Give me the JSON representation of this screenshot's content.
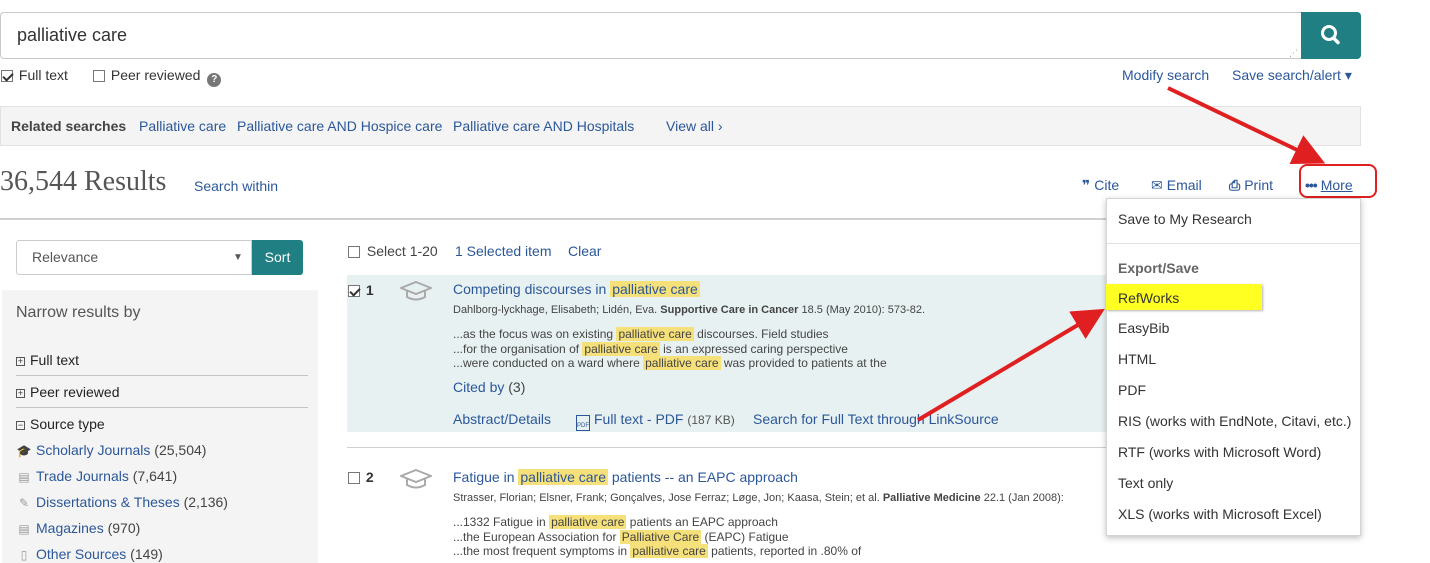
{
  "search": {
    "value": "palliative care",
    "full_text_label": "Full text",
    "peer_reviewed_label": "Peer reviewed",
    "modify_search": "Modify search",
    "save_search": "Save search/alert ▾"
  },
  "related": {
    "heading": "Related searches",
    "links": [
      "Palliative care",
      "Palliative care AND Hospice care",
      "Palliative care AND Hospitals"
    ],
    "view_all": "View all ›"
  },
  "results": {
    "count": "36,544 Results",
    "search_within": "Search within"
  },
  "tools": {
    "cite": "Cite",
    "email": "Email",
    "print": "Print",
    "more": "More"
  },
  "sort": {
    "selected": "Relevance",
    "button": "Sort"
  },
  "narrow": {
    "title": "Narrow results by",
    "facets": [
      "Full text",
      "Peer reviewed",
      "Source type"
    ],
    "sources": [
      {
        "label": "Scholarly Journals",
        "count": "(25,504)"
      },
      {
        "label": "Trade Journals",
        "count": "(7,641)"
      },
      {
        "label": "Dissertations & Theses",
        "count": "(2,136)"
      },
      {
        "label": "Magazines",
        "count": "(970)"
      },
      {
        "label": "Other Sources",
        "count": "(149)"
      }
    ]
  },
  "selection": {
    "select_range": "Select 1-20",
    "selected_items": "1 Selected item",
    "clear": "Clear"
  },
  "items": [
    {
      "num": "1",
      "title_pre": "Competing discourses in",
      "title_hl": "palliative care",
      "title_post": "",
      "authors": "Dahlborg-lyckhage, Elisabeth; Lidén, Eva.",
      "journal": "Supportive Care in Cancer",
      "citation": "18.5  (May 2010): 573-82.",
      "snippets": [
        {
          "pre": "...as the focus was on existing",
          "hl": "palliative care",
          "post": "discourses. Field studies"
        },
        {
          "pre": "...for the organisation of",
          "hl": "palliative care",
          "post": "is an expressed caring perspective"
        },
        {
          "pre": "...were conducted on a ward where",
          "hl": "palliative care",
          "post": "was provided to patients at the"
        }
      ],
      "cited_by": "Cited by",
      "cited_count": "(3)",
      "abstract": "Abstract/Details",
      "full_text": "Full text - PDF",
      "full_text_size": "(187 KB)",
      "linksource": "Search for Full Text through LinkSource"
    },
    {
      "num": "2",
      "title_pre": "Fatigue in",
      "title_hl": "palliative care",
      "title_post": "patients -- an EAPC approach",
      "authors": "Strasser, Florian; Elsner, Frank; Gonçalves, Jose Ferraz; Løge, Jon; Kaasa, Stein; et al.",
      "journal": "Palliative Medicine",
      "citation": "22.1  (Jan 2008):",
      "snippets": [
        {
          "pre": "...1332 Fatigue in",
          "hl": "palliative care",
          "post": "patients an EAPC approach"
        },
        {
          "pre": "...the European Association for",
          "hl": "Palliative Care",
          "post": "(EAPC) Fatigue"
        },
        {
          "pre": "...the most frequent symptoms in",
          "hl": "palliative care",
          "post": "patients, reported in .80% of"
        }
      ]
    }
  ],
  "more_menu": {
    "save_research": "Save to My Research",
    "export_heading": "Export/Save",
    "items": [
      "RefWorks",
      "EasyBib",
      "HTML",
      "PDF",
      "RIS (works with EndNote, Citavi, etc.)",
      "RTF (works with Microsoft Word)",
      "Text only",
      "XLS (works with Microsoft Excel)"
    ]
  },
  "colors": {
    "accent": "#1f7f83",
    "link": "#2b579a",
    "highlight": "#f5e07a",
    "annotation_red": "#e02020",
    "annotation_yellow": "#ffff22"
  }
}
